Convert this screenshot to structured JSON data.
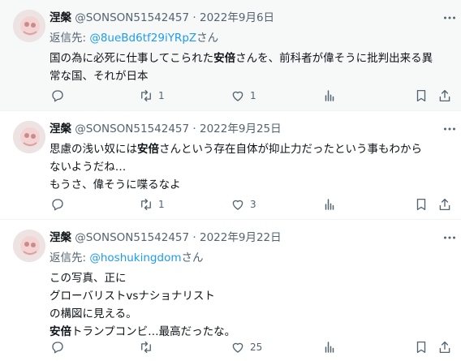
{
  "tweets": [
    {
      "name": "涅槃",
      "handle": "@SONSON51542457",
      "dot": "·",
      "date": "2022年9月6日",
      "reply_prefix": "返信先: ",
      "reply_handle": "@8ueBd6tf29iYRpZ",
      "reply_suffix": "さん",
      "text_parts": [
        "国の為に必死に仕事してこられた",
        "安倍",
        "さんを、前科者が偉そうに批判出来る異\n常な国、それが日本"
      ],
      "counts": {
        "reply": "",
        "retweet": "1",
        "like": "1"
      }
    },
    {
      "name": "涅槃",
      "handle": "@SONSON51542457",
      "dot": "·",
      "date": "2022年9月25日",
      "text_parts": [
        "思慮の浅い奴には",
        "安倍",
        "さんという存在自体が抑止力だったという事もわから\nないようだね…\nもうさ、偉そうに喋るなよ"
      ],
      "counts": {
        "reply": "",
        "retweet": "1",
        "like": "3"
      }
    },
    {
      "name": "涅槃",
      "handle": "@SONSON51542457",
      "dot": "·",
      "date": "2022年9月22日",
      "reply_prefix": "返信先: ",
      "reply_handle": "@hoshukingdom",
      "reply_suffix": "さん",
      "text_parts": [
        "この写真、正に\nグローバリストvsナショナリスト\nの構図に見える。\n",
        "安倍",
        "トランプコンビ…最高だったな。"
      ],
      "counts": {
        "reply": "",
        "retweet": "",
        "like": "25"
      }
    }
  ],
  "icons": {
    "reply": "reply-icon",
    "retweet": "retweet-icon",
    "like": "heart-icon",
    "views": "views-icon",
    "bookmark": "bookmark-icon",
    "share": "share-icon",
    "more": "more-icon"
  },
  "colors": {
    "text": "#0f1419",
    "muted": "#536471",
    "link": "#1d9bf0",
    "divider": "#eff3f4",
    "highlight_bg": "#f7f9f9"
  }
}
